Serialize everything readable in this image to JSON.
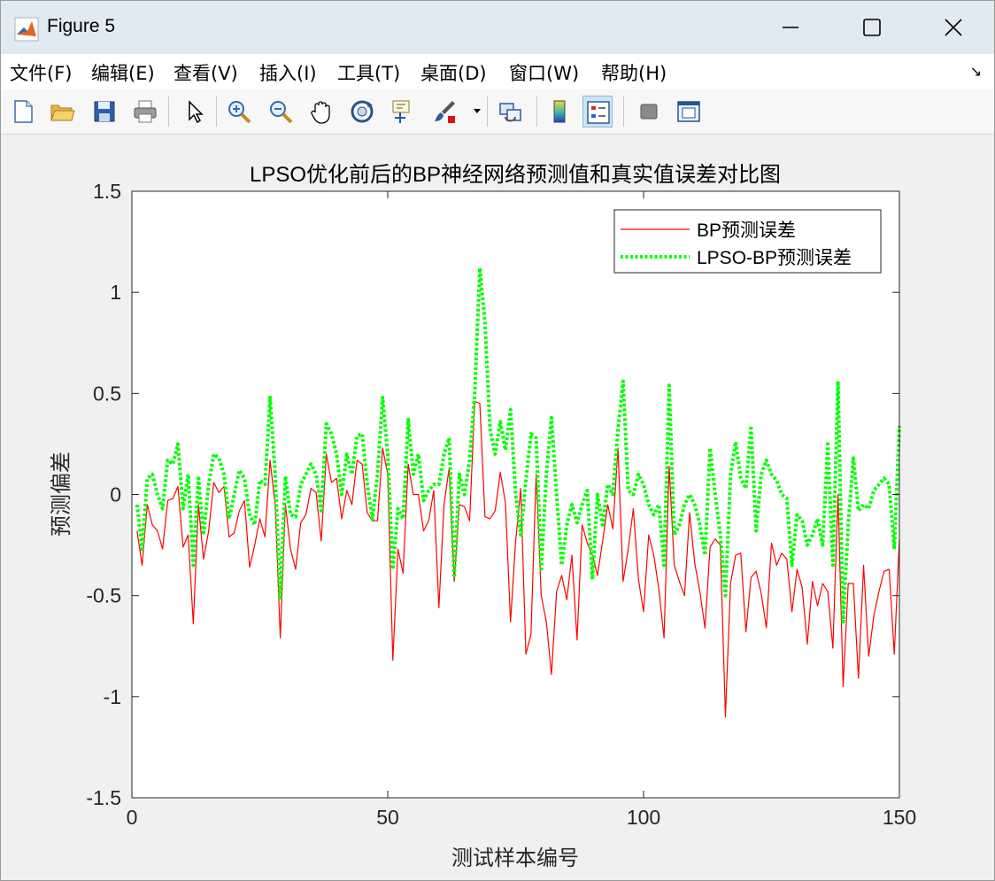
{
  "window": {
    "title": "Figure 5",
    "controls": {
      "minimize": "minimize",
      "maximize": "maximize",
      "close": "close"
    }
  },
  "menu": {
    "items": [
      "文件(F)",
      "编辑(E)",
      "查看(V)",
      "插入(I)",
      "工具(T)",
      "桌面(D)",
      "窗口(W)",
      "帮助(H)"
    ],
    "overflow": "↘"
  },
  "toolbar": {
    "icons": [
      "new-figure-icon",
      "open-file-icon",
      "save-icon",
      "print-icon",
      "select-pointer-icon",
      "zoom-in-icon",
      "zoom-out-icon",
      "pan-hand-icon",
      "rotate-3d-icon",
      "data-cursor-icon",
      "brush-icon",
      "link-plot-icon",
      "colorbar-icon",
      "legend-icon",
      "hide-plot-tools-icon",
      "show-plot-tools-icon"
    ]
  },
  "colors": {
    "bp": "#ff0000",
    "lpso": "#00ff00",
    "axes_bg": "#ffffff",
    "figure_bg": "#f0f0f0"
  },
  "chart_data": {
    "type": "line",
    "title": "LPSO优化前后的BP神经网络预测值和真实值误差对比图",
    "xlabel": "测试样本编号",
    "ylabel": "预测偏差",
    "xlim": [
      0,
      150
    ],
    "ylim": [
      -1.5,
      1.5
    ],
    "xticks": [
      "0",
      "50",
      "100",
      "150"
    ],
    "yticks": [
      "1.5",
      "1",
      "0.5",
      "0",
      "-0.5",
      "-1",
      "-1.5"
    ],
    "grid": false,
    "legend_position": "top-right",
    "legend": [
      "BP预测误差",
      "LPSO-BP预测误差"
    ],
    "x": [
      1,
      2,
      3,
      4,
      5,
      6,
      7,
      8,
      9,
      10,
      11,
      12,
      13,
      14,
      15,
      16,
      17,
      18,
      19,
      20,
      21,
      22,
      23,
      24,
      25,
      26,
      27,
      28,
      29,
      30,
      31,
      32,
      33,
      34,
      35,
      36,
      37,
      38,
      39,
      40,
      41,
      42,
      43,
      44,
      45,
      46,
      47,
      48,
      49,
      50,
      51,
      52,
      53,
      54,
      55,
      56,
      57,
      58,
      59,
      60,
      61,
      62,
      63,
      64,
      65,
      66,
      67,
      68,
      69,
      70,
      71,
      72,
      73,
      74,
      75,
      76,
      77,
      78,
      79,
      80,
      81,
      82,
      83,
      84,
      85,
      86,
      87,
      88,
      89,
      90,
      91,
      92,
      93,
      94,
      95,
      96,
      97,
      98,
      99,
      100,
      101,
      102,
      103,
      104,
      105,
      106,
      107,
      108,
      109,
      110,
      111,
      112,
      113,
      114,
      115,
      116,
      117,
      118,
      119,
      120,
      121,
      122,
      123,
      124,
      125,
      126,
      127,
      128,
      129,
      130,
      131,
      132,
      133,
      134,
      135,
      136,
      137,
      138,
      139,
      140,
      141,
      142,
      143,
      144,
      145,
      146,
      147,
      148,
      149,
      150
    ],
    "series": [
      {
        "name": "BP预测误差",
        "style": "solid",
        "values": [
          -0.18,
          -0.35,
          -0.05,
          -0.15,
          -0.18,
          -0.27,
          -0.03,
          -0.02,
          0.04,
          -0.26,
          -0.2,
          -0.64,
          -0.05,
          -0.32,
          -0.18,
          0.06,
          0.01,
          0.04,
          -0.21,
          -0.19,
          -0.08,
          -0.03,
          -0.36,
          -0.25,
          -0.12,
          -0.21,
          0.17,
          -0.05,
          -0.71,
          -0.05,
          -0.27,
          -0.37,
          -0.14,
          -0.1,
          0.03,
          0.01,
          -0.23,
          0.2,
          0.06,
          0.08,
          -0.12,
          0.02,
          -0.05,
          0.17,
          0.15,
          -0.09,
          -0.13,
          -0.13,
          0.23,
          0.1,
          -0.82,
          -0.27,
          -0.39,
          0.15,
          0.0,
          0.0,
          -0.18,
          -0.13,
          0.02,
          -0.56,
          -0.05,
          0.13,
          -0.43,
          -0.05,
          -0.06,
          -0.13,
          0.46,
          0.45,
          -0.11,
          -0.12,
          -0.08,
          0.11,
          -0.04,
          -0.63,
          -0.23,
          0.03,
          -0.79,
          -0.69,
          0.1,
          -0.5,
          -0.63,
          -0.89,
          -0.48,
          -0.4,
          -0.52,
          -0.3,
          -0.72,
          -0.15,
          -0.24,
          -0.3,
          -0.4,
          -0.23,
          -0.05,
          -0.17,
          0.23,
          -0.43,
          -0.27,
          -0.07,
          -0.42,
          -0.58,
          -0.2,
          -0.3,
          -0.47,
          -0.71,
          0.14,
          -0.35,
          -0.43,
          -0.5,
          -0.09,
          -0.34,
          -0.48,
          -0.66,
          -0.26,
          -0.22,
          -0.25,
          -1.1,
          -0.44,
          -0.3,
          -0.29,
          -0.68,
          -0.41,
          -0.38,
          -0.49,
          -0.66,
          -0.24,
          -0.35,
          -0.29,
          -0.32,
          -0.58,
          -0.37,
          -0.46,
          -0.74,
          -0.43,
          -0.55,
          -0.44,
          -0.48,
          -0.76,
          0.0,
          -0.95,
          -0.44,
          -0.44,
          -0.91,
          -0.35,
          -0.8,
          -0.6,
          -0.48,
          -0.38,
          -0.37,
          -0.79,
          -0.22,
          -0.32
        ]
      },
      {
        "name": "LPSO-BP预测误差",
        "style": "dotted",
        "values": [
          -0.05,
          -0.27,
          0.08,
          0.1,
          0.0,
          -0.07,
          0.17,
          0.15,
          0.25,
          -0.07,
          0.1,
          -0.35,
          0.08,
          -0.2,
          0.05,
          0.2,
          0.18,
          0.1,
          -0.12,
          0.0,
          0.12,
          0.08,
          -0.1,
          -0.15,
          0.07,
          0.05,
          0.48,
          0.1,
          -0.52,
          0.09,
          -0.1,
          -0.11,
          0.05,
          0.1,
          0.15,
          0.1,
          -0.08,
          0.35,
          0.3,
          0.2,
          0.0,
          0.2,
          0.1,
          0.29,
          0.3,
          0.05,
          -0.12,
          0.1,
          0.48,
          0.2,
          -0.37,
          -0.07,
          -0.12,
          0.37,
          0.1,
          0.2,
          -0.03,
          0.02,
          0.05,
          0.05,
          0.2,
          0.28,
          -0.4,
          0.1,
          0.0,
          0.17,
          0.5,
          1.12,
          0.85,
          0.32,
          0.2,
          0.36,
          0.22,
          0.42,
          0.0,
          -0.2,
          0.07,
          0.3,
          0.28,
          -0.38,
          0.1,
          0.38,
          0.0,
          -0.35,
          -0.15,
          -0.05,
          -0.14,
          -0.05,
          0.02,
          -0.42,
          0.0,
          -0.15,
          0.05,
          0.0,
          0.32,
          0.56,
          0.02,
          0.0,
          0.1,
          0.05,
          -0.05,
          -0.1,
          -0.05,
          -0.35,
          0.54,
          -0.2,
          -0.15,
          -0.05,
          0.0,
          -0.05,
          -0.15,
          -0.3,
          0.23,
          0.0,
          -0.2,
          -0.5,
          0.1,
          0.26,
          0.08,
          0.03,
          0.34,
          -0.18,
          0.1,
          0.17,
          0.1,
          0.07,
          0.0,
          -0.02,
          -0.35,
          -0.1,
          -0.13,
          -0.25,
          -0.2,
          -0.12,
          -0.25,
          0.25,
          -0.35,
          0.56,
          -0.63,
          -0.15,
          0.18,
          -0.08,
          -0.05,
          -0.07,
          0.02,
          0.05,
          0.08,
          0.05,
          -0.27,
          0.34,
          0.17
        ]
      }
    ]
  }
}
